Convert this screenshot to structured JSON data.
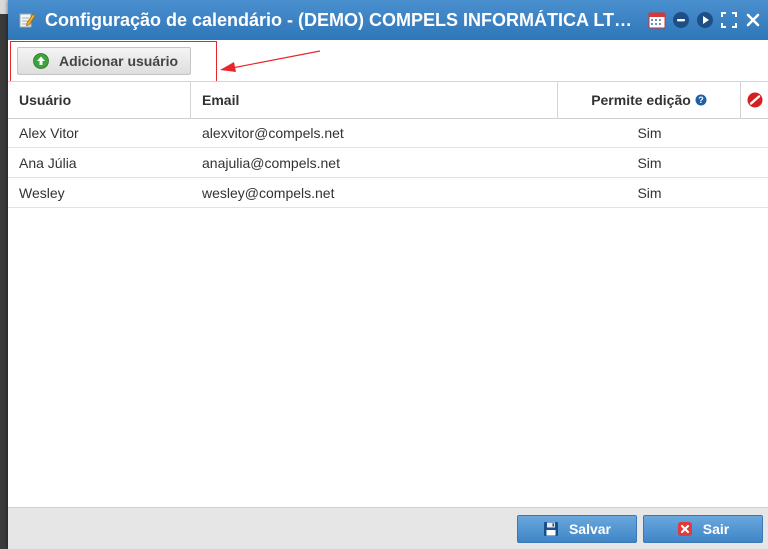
{
  "window": {
    "title": "Configuração de calendário - (DEMO) COMPELS INFORMÁTICA LTDA..."
  },
  "toolbar": {
    "add_user_label": "Adicionar usuário"
  },
  "table": {
    "headers": {
      "user": "Usuário",
      "email": "Email",
      "edit": "Permite edição"
    },
    "rows": [
      {
        "user": "Alex Vitor",
        "email": "alexvitor@compels.net",
        "edit": "Sim"
      },
      {
        "user": "Ana Júlia",
        "email": "anajulia@compels.net",
        "edit": "Sim"
      },
      {
        "user": "Wesley",
        "email": "wesley@compels.net",
        "edit": "Sim"
      }
    ]
  },
  "footer": {
    "save_label": "Salvar",
    "exit_label": "Sair"
  },
  "colors": {
    "titlebar": "#3a80c2",
    "highlight": "#e8262d",
    "button_blue": "#4f92d0"
  },
  "icons": {
    "title": "edit-pencil-icon",
    "tools": [
      "calendar-icon",
      "minimize-icon",
      "play-icon",
      "maximize-icon",
      "close-icon"
    ],
    "add": "plus-circle-icon",
    "help": "question-circle-icon",
    "header_extra": "no-entry-icon",
    "save": "floppy-disk-icon",
    "exit": "cancel-icon"
  }
}
